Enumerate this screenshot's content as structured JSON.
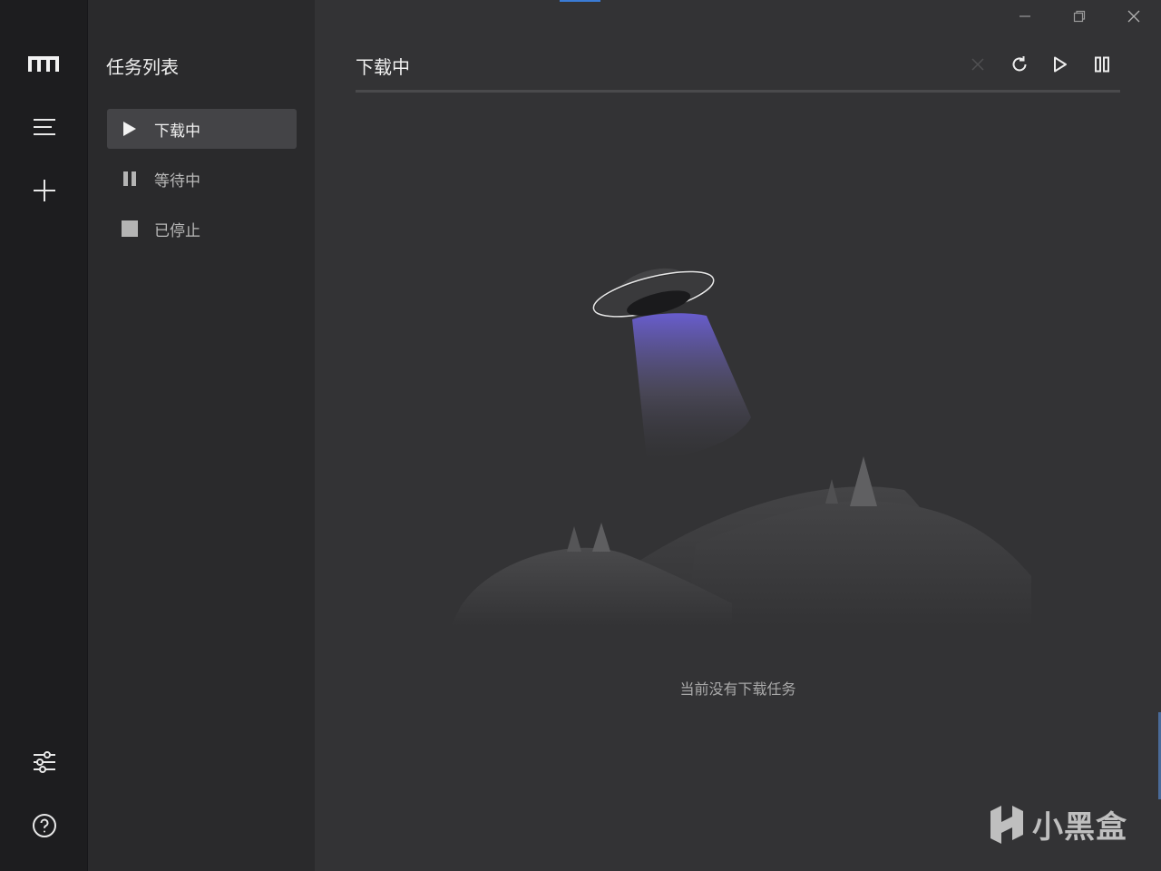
{
  "rail": {
    "logo": "m-logo-icon",
    "menu": "hamburger-menu-icon",
    "add": "plus-icon",
    "settings": "sliders-icon",
    "help": "help-circle-icon"
  },
  "sidebar": {
    "title": "任务列表",
    "items": [
      {
        "label": "下载中",
        "icon": "play-icon",
        "active": true
      },
      {
        "label": "等待中",
        "icon": "pause-icon",
        "active": false
      },
      {
        "label": "已停止",
        "icon": "stop-icon",
        "active": false
      }
    ]
  },
  "main": {
    "title": "下载中",
    "toolbar": [
      "close-icon",
      "refresh-icon",
      "play-icon",
      "pause-icon"
    ],
    "empty_message": "当前没有下载任务"
  },
  "window_controls": [
    "minimize-icon",
    "maximize-icon",
    "close-window-icon"
  ],
  "watermark": {
    "text": "小黑盒"
  },
  "colors": {
    "rail": "#1d1d1f",
    "sidebar": "#2a2a2c",
    "main": "#333335",
    "active_item": "#444447",
    "beam": "#6b5fd6"
  }
}
